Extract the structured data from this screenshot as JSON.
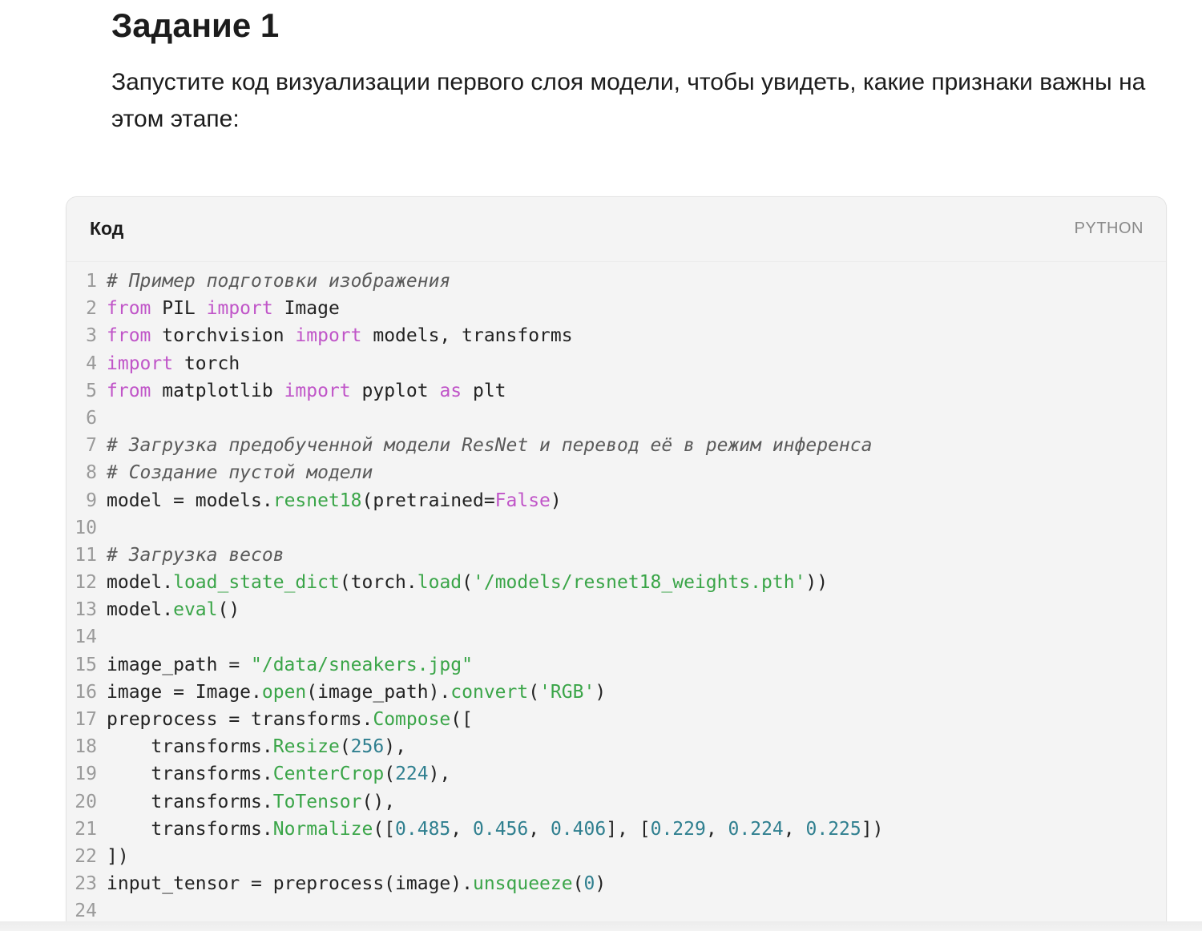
{
  "task": {
    "title": "Задание 1",
    "text": "Запустите код визуализации первого слоя модели, чтобы увидеть, какие признаки важны на этом этапе:"
  },
  "code_block": {
    "title": "Код",
    "language": "PYTHON",
    "lines": [
      {
        "n": "1",
        "tokens": [
          {
            "t": "comment",
            "v": "# Пример подготовки изображения"
          }
        ]
      },
      {
        "n": "2",
        "tokens": [
          {
            "t": "keyword",
            "v": "from"
          },
          {
            "t": "plain",
            "v": " PIL "
          },
          {
            "t": "keyword",
            "v": "import"
          },
          {
            "t": "plain",
            "v": " Image"
          }
        ]
      },
      {
        "n": "3",
        "tokens": [
          {
            "t": "keyword",
            "v": "from"
          },
          {
            "t": "plain",
            "v": " torchvision "
          },
          {
            "t": "keyword",
            "v": "import"
          },
          {
            "t": "plain",
            "v": " models, transforms"
          }
        ]
      },
      {
        "n": "4",
        "tokens": [
          {
            "t": "keyword",
            "v": "import"
          },
          {
            "t": "plain",
            "v": " torch"
          }
        ]
      },
      {
        "n": "5",
        "tokens": [
          {
            "t": "keyword",
            "v": "from"
          },
          {
            "t": "plain",
            "v": " matplotlib "
          },
          {
            "t": "keyword",
            "v": "import"
          },
          {
            "t": "plain",
            "v": " pyplot "
          },
          {
            "t": "keyword",
            "v": "as"
          },
          {
            "t": "plain",
            "v": " plt"
          }
        ]
      },
      {
        "n": "6",
        "tokens": []
      },
      {
        "n": "7",
        "tokens": [
          {
            "t": "comment",
            "v": "# Загрузка предобученной модели ResNet и перевод её в режим инференса"
          }
        ]
      },
      {
        "n": "8",
        "tokens": [
          {
            "t": "comment",
            "v": "# Создание пустой модели"
          }
        ]
      },
      {
        "n": "9",
        "tokens": [
          {
            "t": "plain",
            "v": "model = models."
          },
          {
            "t": "func",
            "v": "resnet18"
          },
          {
            "t": "plain",
            "v": "(pretrained="
          },
          {
            "t": "keyword",
            "v": "False"
          },
          {
            "t": "plain",
            "v": ")"
          }
        ]
      },
      {
        "n": "10",
        "tokens": []
      },
      {
        "n": "11",
        "tokens": [
          {
            "t": "comment",
            "v": "# Загрузка весов"
          }
        ]
      },
      {
        "n": "12",
        "tokens": [
          {
            "t": "plain",
            "v": "model."
          },
          {
            "t": "func",
            "v": "load_state_dict"
          },
          {
            "t": "plain",
            "v": "(torch."
          },
          {
            "t": "func",
            "v": "load"
          },
          {
            "t": "plain",
            "v": "("
          },
          {
            "t": "string",
            "v": "'/models/resnet18_weights.pth'"
          },
          {
            "t": "plain",
            "v": "))"
          }
        ]
      },
      {
        "n": "13",
        "tokens": [
          {
            "t": "plain",
            "v": "model."
          },
          {
            "t": "func",
            "v": "eval"
          },
          {
            "t": "plain",
            "v": "()"
          }
        ]
      },
      {
        "n": "14",
        "tokens": []
      },
      {
        "n": "15",
        "tokens": [
          {
            "t": "plain",
            "v": "image_path = "
          },
          {
            "t": "string",
            "v": "\"/data/sneakers.jpg\""
          }
        ]
      },
      {
        "n": "16",
        "tokens": [
          {
            "t": "plain",
            "v": "image = Image."
          },
          {
            "t": "func",
            "v": "open"
          },
          {
            "t": "plain",
            "v": "(image_path)."
          },
          {
            "t": "func",
            "v": "convert"
          },
          {
            "t": "plain",
            "v": "("
          },
          {
            "t": "string",
            "v": "'RGB'"
          },
          {
            "t": "plain",
            "v": ")"
          }
        ]
      },
      {
        "n": "17",
        "tokens": [
          {
            "t": "plain",
            "v": "preprocess = transforms."
          },
          {
            "t": "func",
            "v": "Compose"
          },
          {
            "t": "plain",
            "v": "(["
          }
        ]
      },
      {
        "n": "18",
        "tokens": [
          {
            "t": "plain",
            "v": "    transforms."
          },
          {
            "t": "func",
            "v": "Resize"
          },
          {
            "t": "plain",
            "v": "("
          },
          {
            "t": "number",
            "v": "256"
          },
          {
            "t": "plain",
            "v": "),"
          }
        ]
      },
      {
        "n": "19",
        "tokens": [
          {
            "t": "plain",
            "v": "    transforms."
          },
          {
            "t": "func",
            "v": "CenterCrop"
          },
          {
            "t": "plain",
            "v": "("
          },
          {
            "t": "number",
            "v": "224"
          },
          {
            "t": "plain",
            "v": "),"
          }
        ]
      },
      {
        "n": "20",
        "tokens": [
          {
            "t": "plain",
            "v": "    transforms."
          },
          {
            "t": "func",
            "v": "ToTensor"
          },
          {
            "t": "plain",
            "v": "(),"
          }
        ]
      },
      {
        "n": "21",
        "tokens": [
          {
            "t": "plain",
            "v": "    transforms."
          },
          {
            "t": "func",
            "v": "Normalize"
          },
          {
            "t": "plain",
            "v": "(["
          },
          {
            "t": "number",
            "v": "0.485"
          },
          {
            "t": "plain",
            "v": ", "
          },
          {
            "t": "number",
            "v": "0.456"
          },
          {
            "t": "plain",
            "v": ", "
          },
          {
            "t": "number",
            "v": "0.406"
          },
          {
            "t": "plain",
            "v": "], ["
          },
          {
            "t": "number",
            "v": "0.229"
          },
          {
            "t": "plain",
            "v": ", "
          },
          {
            "t": "number",
            "v": "0.224"
          },
          {
            "t": "plain",
            "v": ", "
          },
          {
            "t": "number",
            "v": "0.225"
          },
          {
            "t": "plain",
            "v": "])"
          }
        ]
      },
      {
        "n": "22",
        "tokens": [
          {
            "t": "plain",
            "v": "])"
          }
        ]
      },
      {
        "n": "23",
        "tokens": [
          {
            "t": "plain",
            "v": "input_tensor = preprocess(image)."
          },
          {
            "t": "func",
            "v": "unsqueeze"
          },
          {
            "t": "plain",
            "v": "("
          },
          {
            "t": "number",
            "v": "0"
          },
          {
            "t": "plain",
            "v": ")"
          }
        ]
      },
      {
        "n": "24",
        "tokens": []
      }
    ]
  },
  "colors": {
    "keyword": "#c055c8",
    "function": "#3aa548",
    "string": "#3aa548",
    "number": "#2f7f8f",
    "comment": "#5a5a5a",
    "code_background": "#f4f4f4"
  }
}
